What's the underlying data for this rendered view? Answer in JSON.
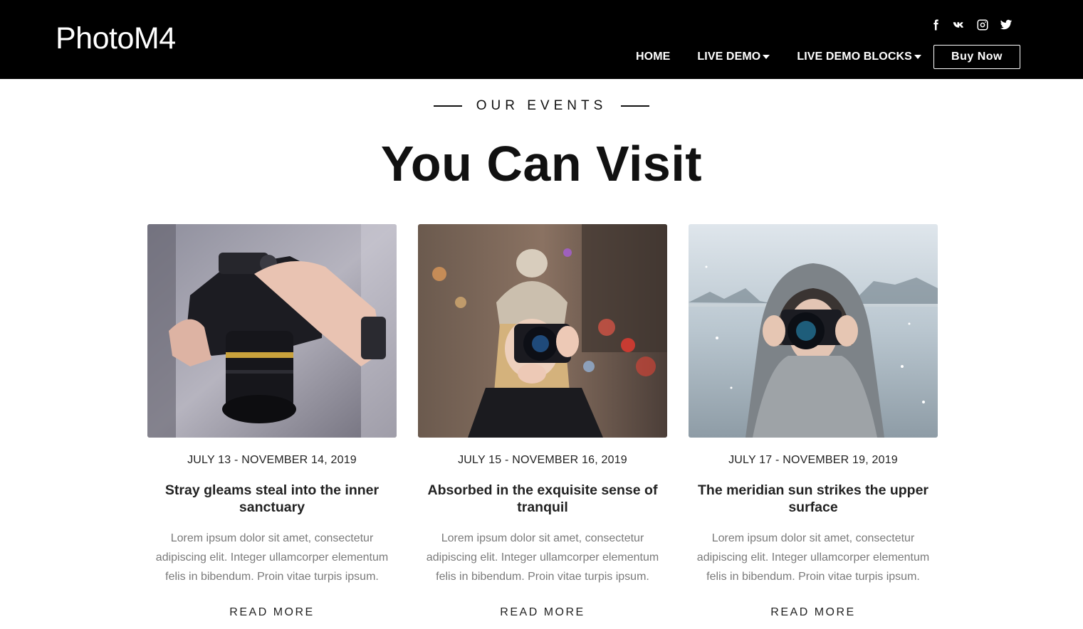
{
  "header": {
    "logo": "PhotoM4",
    "social": [
      "facebook-icon",
      "vk-icon",
      "instagram-icon",
      "twitter-icon"
    ],
    "nav": [
      {
        "label": "HOME",
        "dropdown": false
      },
      {
        "label": "LIVE DEMO",
        "dropdown": true
      },
      {
        "label": "LIVE DEMO BLOCKS",
        "dropdown": true
      }
    ],
    "cta": "Buy Now"
  },
  "section": {
    "eyebrow": "OUR EVENTS",
    "title": "You Can Visit"
  },
  "cards": [
    {
      "photo": "camera-hands-photo",
      "date": "JULY 13 - NOVEMBER 14, 2019",
      "title": "Stray gleams steal into the inner sanctuary",
      "desc": "Lorem ipsum dolor sit amet, consectetur adipiscing elit. Integer ullamcorper elementum felis in bibendum. Proin vitae turpis ipsum.",
      "more": "READ MORE"
    },
    {
      "photo": "woman-beanie-camera-photo",
      "date": "JULY 15 - NOVEMBER 16, 2019",
      "title": "Absorbed in the exquisite sense of tranquil",
      "desc": "Lorem ipsum dolor sit amet, consectetur adipiscing elit. Integer ullamcorper elementum felis in bibendum. Proin vitae turpis ipsum.",
      "more": "READ MORE"
    },
    {
      "photo": "snow-hood-camera-photo",
      "date": "JULY 17 - NOVEMBER 19, 2019",
      "title": "The meridian sun strikes the upper surface",
      "desc": "Lorem ipsum dolor sit amet, consectetur adipiscing elit. Integer ullamcorper elementum felis in bibendum. Proin vitae turpis ipsum.",
      "more": "READ MORE"
    }
  ],
  "colors": {
    "header_bg": "#000000",
    "header_text": "#ffffff",
    "text_dark": "#111111",
    "text_muted": "#7a7a7a"
  }
}
